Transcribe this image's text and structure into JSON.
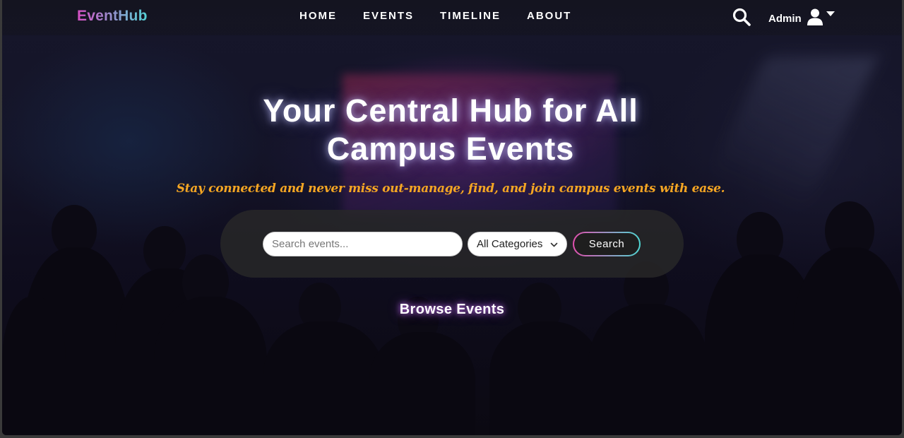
{
  "navbar": {
    "logo": "EventHub",
    "links": [
      {
        "label": "HOME"
      },
      {
        "label": "EVENTS"
      },
      {
        "label": "TIMELINE"
      },
      {
        "label": "ABOUT"
      }
    ],
    "search_icon": "search-icon",
    "user": {
      "label": "Admin",
      "icon": "user-icon",
      "caret": "caret-down-icon"
    }
  },
  "hero": {
    "title_line1": "Your Central Hub for All",
    "title_line2": "Campus Events",
    "subtitle": "Stay connected and never miss out-manage, find, and join campus events with ease."
  },
  "search": {
    "placeholder": "Search events...",
    "value": "",
    "category_selected": "All Categories",
    "button_label": "Search"
  },
  "browse": {
    "heading": "Browse Events"
  },
  "colors": {
    "logo_gradient_start": "#d64fc4",
    "logo_gradient_end": "#53d3d6",
    "subtitle": "#f5a623",
    "button_border_start": "#e04fae",
    "button_border_end": "#4fd6d2"
  }
}
